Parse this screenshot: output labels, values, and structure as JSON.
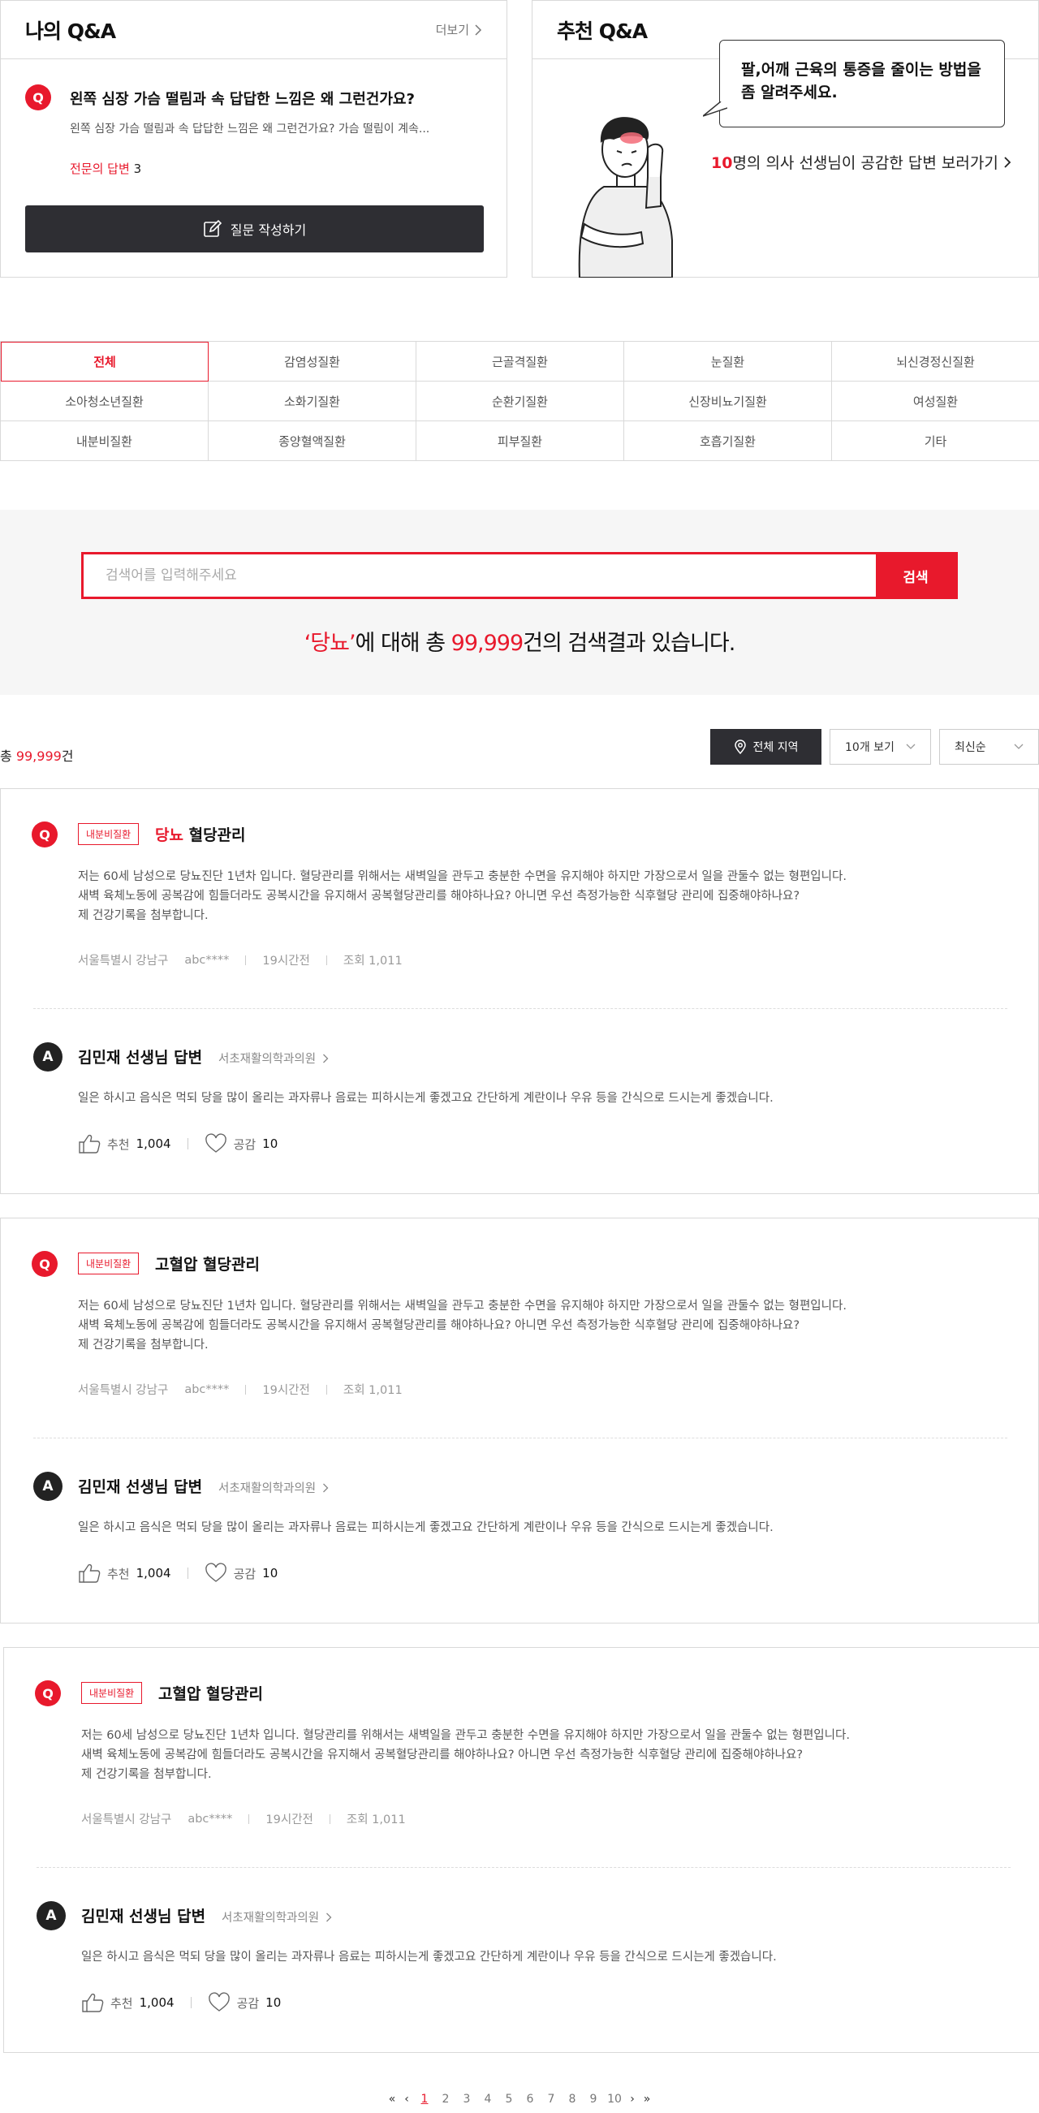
{
  "my_qa": {
    "title": "나의 Q&A",
    "more_label": "더보기",
    "question_badge": "Q",
    "question_title": "왼쪽 심장 가슴 떨림과 속 답답한 느낌은 왜 그런건가요?",
    "question_desc": "왼쪽 심장 가슴 떨림과 속 답답한 느낌은 왜 그런건가요? 가슴 떨림이 계속...",
    "expert_answer_label": "전문의 답변",
    "expert_answer_count": "3",
    "write_button_label": "질문 작성하기"
  },
  "recommended_qa": {
    "title": "추천 Q&A",
    "bubble_text": "팔,어깨 근육의 통증을  줄이는 방법을 좀 알려주세요.",
    "doctor_count": "10",
    "link_text": "명의 의사 선생님이 공감한 답변 보러가기"
  },
  "categories": [
    {
      "label": "전체",
      "active": true
    },
    {
      "label": "감염성질환"
    },
    {
      "label": "근골격질환"
    },
    {
      "label": "눈질환"
    },
    {
      "label": "뇌신경정신질환"
    },
    {
      "label": "소아청소년질환"
    },
    {
      "label": "소화기질환"
    },
    {
      "label": "순환기질환"
    },
    {
      "label": "신장비뇨기질환"
    },
    {
      "label": "여성질환"
    },
    {
      "label": "내분비질환"
    },
    {
      "label": "종양혈액질환"
    },
    {
      "label": "피부질환"
    },
    {
      "label": "호흡기질환"
    },
    {
      "label": "기타"
    }
  ],
  "search": {
    "placeholder": "검색어를 입력해주세요",
    "button_label": "검색",
    "result_keyword": "‘당뇨’",
    "result_mid": "에 대해 총 ",
    "result_count": "99,999",
    "result_suffix": "건의 검색결과 있습니다."
  },
  "list_header": {
    "total_prefix": "총 ",
    "total_count": "99,999",
    "total_suffix": "건",
    "region_label": "전체 지역",
    "per_page_label": "10개 보기",
    "sort_label": "최신순"
  },
  "cards": [
    {
      "tag": "내분비질환",
      "title_highlight": "당뇨",
      "title_rest": " 혈당관리",
      "body_lines": [
        "저는 60세 남성으로 당뇨진단 1년차 입니다. 혈당관리를 위해서는 새벽일을 관두고 충분한 수면을 유지해야 하지만 가장으로서 일을 관둘수 없는 형편입니다.",
        "새벽 육체노동에 공복감에 힘들더라도 공복시간을 유지해서 공복혈당관리를 해야하나요?  아니면 우선 측정가능한 식후혈당 관리에 집중해야하나요?",
        "제 건강기록을 첨부합니다."
      ],
      "location": "서울특별시 강남구",
      "user": "abc****",
      "time": "19시간전",
      "views": "조회 1,011",
      "answer_badge": "A",
      "answer_title": "김민재 선생님 답변",
      "clinic": "서초재활의학과의원",
      "answer_body": "일은 하시고 음식은 먹되 당을 많이 올리는 과자류나 음료는 피하시는게 좋겠고요 간단하게 계란이나 우유 등을 간식으로 드시는게 좋겠습니다.",
      "recommend_label": "추천",
      "recommend_count": "1,004",
      "empathy_label": "공감",
      "empathy_count": "10"
    },
    {
      "tag": "내분비질환",
      "title_highlight": "",
      "title_rest": "고혈압 혈당관리",
      "body_lines": [
        "저는 60세 남성으로 당뇨진단 1년차 입니다. 혈당관리를 위해서는 새벽일을 관두고 충분한 수면을 유지해야 하지만 가장으로서 일을 관둘수 없는 형편입니다.",
        "새벽 육체노동에 공복감에 힘들더라도 공복시간을 유지해서 공복혈당관리를 해야하나요?  아니면 우선 측정가능한 식후혈당 관리에 집중해야하나요?",
        "제 건강기록을 첨부합니다."
      ],
      "location": "서울특별시 강남구",
      "user": "abc****",
      "time": "19시간전",
      "views": "조회 1,011",
      "answer_badge": "A",
      "answer_title": "김민재 선생님 답변",
      "clinic": "서초재활의학과의원",
      "answer_body": "일은 하시고 음식은 먹되 당을 많이 올리는 과자류나 음료는 피하시는게 좋겠고요 간단하게 계란이나 우유 등을 간식으로 드시는게 좋겠습니다.",
      "recommend_label": "추천",
      "recommend_count": "1,004",
      "empathy_label": "공감",
      "empathy_count": "10"
    },
    {
      "tag": "내분비질환",
      "title_highlight": "",
      "title_rest": "고혈압 혈당관리",
      "body_lines": [
        "저는 60세 남성으로 당뇨진단 1년차 입니다. 혈당관리를 위해서는 새벽일을 관두고 충분한 수면을 유지해야 하지만 가장으로서 일을 관둘수 없는 형편입니다.",
        "새벽 육체노동에 공복감에 힘들더라도 공복시간을 유지해서 공복혈당관리를 해야하나요?  아니면 우선 측정가능한 식후혈당 관리에 집중해야하나요?",
        "제 건강기록을 첨부합니다."
      ],
      "location": "서울특별시 강남구",
      "user": "abc****",
      "time": "19시간전",
      "views": "조회 1,011",
      "answer_badge": "A",
      "answer_title": "김민재 선생님 답변",
      "clinic": "서초재활의학과의원",
      "answer_body": "일은 하시고 음식은 먹되 당을 많이 올리는 과자류나 음료는 피하시는게 좋겠고요 간단하게 계란이나 우유 등을 간식으로 드시는게 좋겠습니다.",
      "recommend_label": "추천",
      "recommend_count": "1,004",
      "empathy_label": "공감",
      "empathy_count": "10"
    }
  ],
  "pagination": {
    "first": "«",
    "prev": "‹",
    "pages": [
      "1",
      "2",
      "3",
      "4",
      "5",
      "6",
      "7",
      "8",
      "9",
      "10"
    ],
    "current": "1",
    "next": "›",
    "last": "»"
  },
  "colors": {
    "accent": "#e8192c",
    "dark": "#2e2e33"
  }
}
